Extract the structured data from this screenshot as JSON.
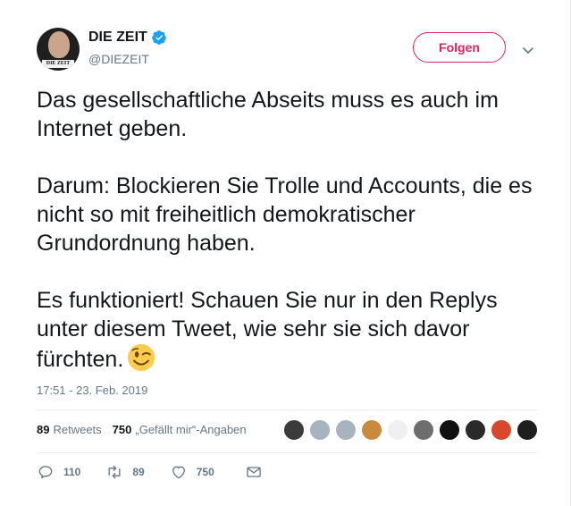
{
  "author": {
    "display_name": "DIE ZEIT",
    "handle": "@DIEZEIT",
    "verified": true,
    "avatar_brand": "DIE ZEIT"
  },
  "follow_label": "Folgen",
  "tweet": {
    "paragraphs": [
      "Das gesellschaftliche Abseits muss es auch im Internet geben.",
      "Darum: Blockieren Sie Trolle und Accounts, die es nicht so mit freiheitlich demokratischer Grundordnung haben.",
      "Es funktioniert! Schauen Sie nur in den Replys unter diesem Tweet, wie sehr sie sich davor fürchten."
    ],
    "emoji": "winking-face",
    "timestamp": "17:51 - 23. Feb. 2019"
  },
  "stats": {
    "retweets_count": "89",
    "retweets_label": "Retweets",
    "likes_count": "750",
    "likes_label": "„Gefällt mir“-Angaben"
  },
  "likers": [
    {
      "icon": "liker-avatar",
      "color": "#3b3b3b"
    },
    {
      "icon": "liker-avatar",
      "color": "#a7b3bf"
    },
    {
      "icon": "liker-avatar",
      "color": "#a7b3bf"
    },
    {
      "icon": "liker-avatar",
      "color": "#c98a3e"
    },
    {
      "icon": "liker-avatar",
      "color": "#f0f0f0"
    },
    {
      "icon": "liker-avatar",
      "color": "#6e6e6e"
    },
    {
      "icon": "liker-avatar",
      "color": "#111111"
    },
    {
      "icon": "liker-avatar",
      "color": "#2a2a2a"
    },
    {
      "icon": "liker-avatar",
      "color": "#d9482b"
    },
    {
      "icon": "liker-avatar",
      "color": "#1e1e1e"
    }
  ],
  "actions": {
    "reply_count": "110",
    "retweet_count": "89",
    "like_count": "750"
  },
  "colors": {
    "accent": "#e0245e",
    "verified": "#1da1f2",
    "secondary_text": "#657786"
  }
}
